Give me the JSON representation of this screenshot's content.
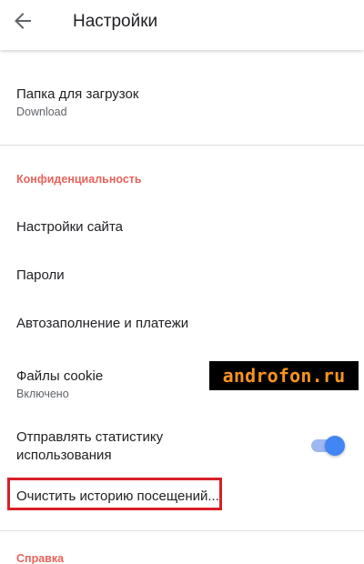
{
  "appbar": {
    "title": "Настройки",
    "back_icon": "arrow-back-icon"
  },
  "downloads": {
    "title": "Папка для загрузок",
    "value": "Download"
  },
  "privacy": {
    "header": "Конфиденциальность",
    "items": {
      "site_settings": "Настройки сайта",
      "passwords": "Пароли",
      "autofill": "Автозаполнение и платежи",
      "cookies_title": "Файлы cookie",
      "cookies_value": "Включено",
      "usage_stats_line1": "Отправлять статистику",
      "usage_stats_line2": "использования",
      "clear_history": "Очистить историю посещений..."
    },
    "usage_stats_enabled": true
  },
  "help": {
    "header": "Справка"
  },
  "watermark": "androfon.ru",
  "colors": {
    "accent_header": "#e8635a",
    "toggle_on": "#4285f4",
    "highlight": "#d71f26",
    "watermark_text": "#f7941d"
  }
}
